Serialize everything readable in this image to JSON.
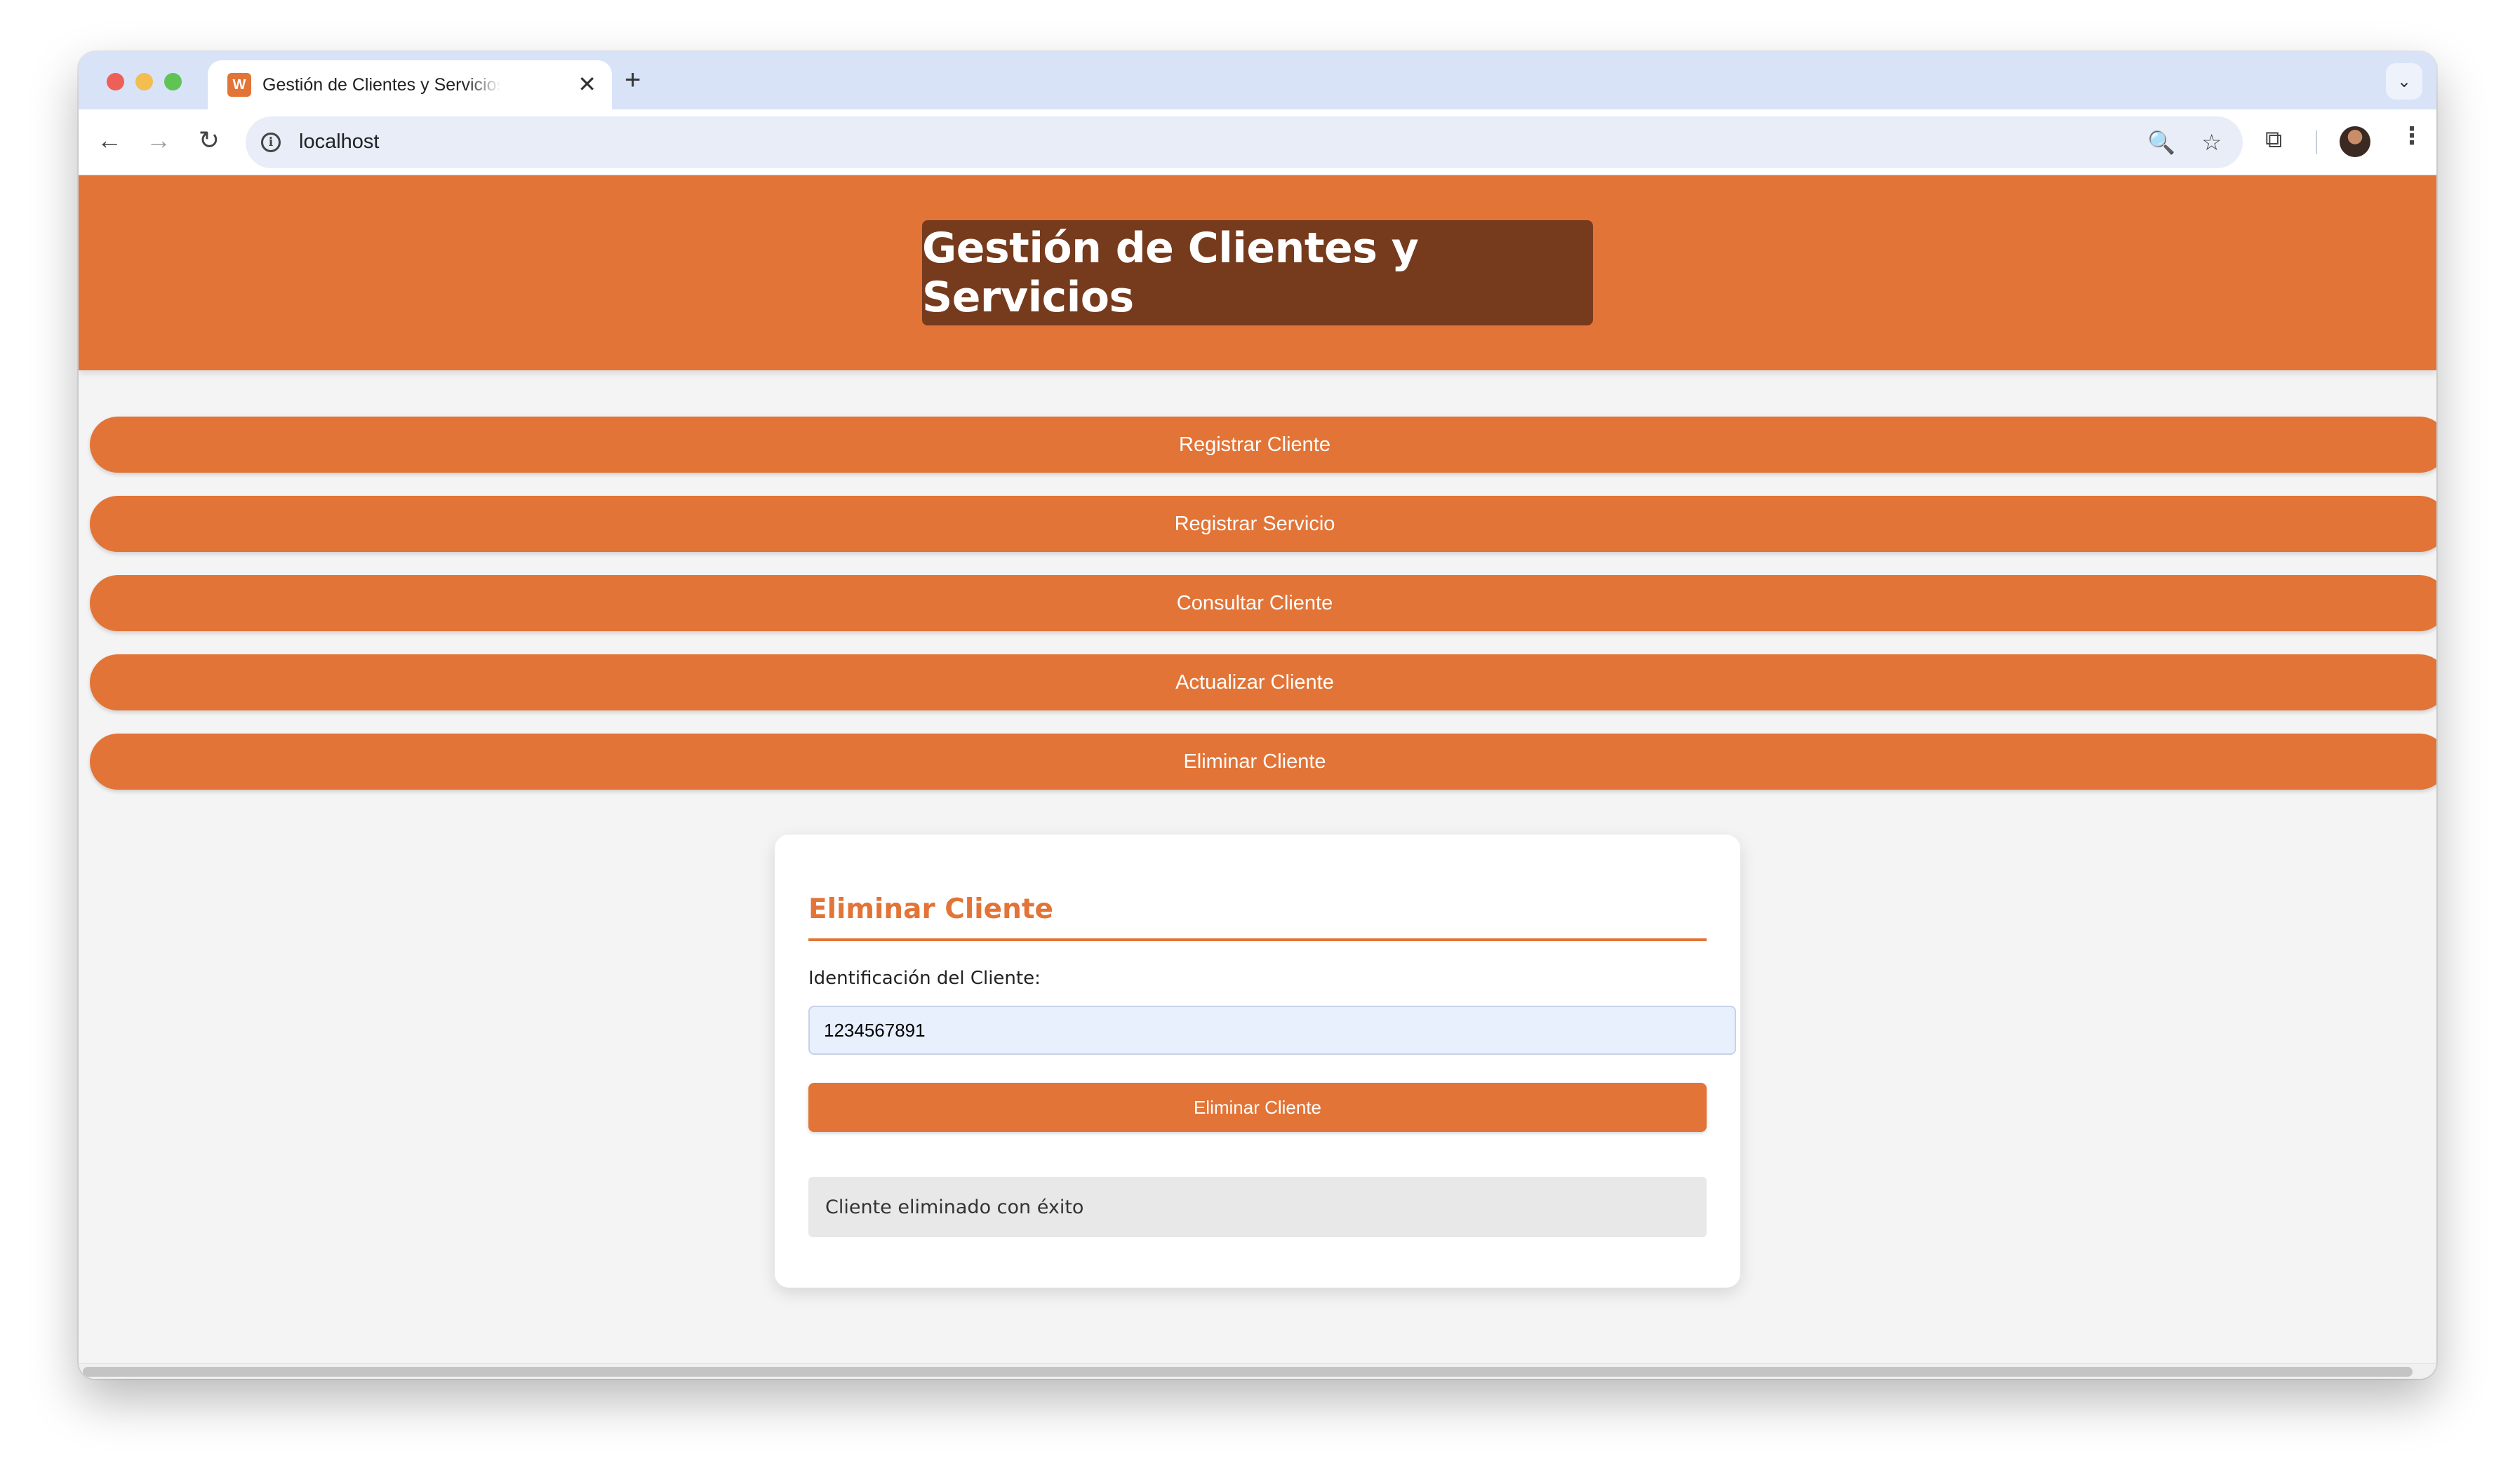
{
  "browser": {
    "tab_title": "Gestión de Clientes y Servicios",
    "favicon_glyph": "W",
    "close_glyph": "✕",
    "new_tab_glyph": "+",
    "dropdown_glyph": "⌄",
    "url": "localhost",
    "icons": {
      "back": "←",
      "forward": "→",
      "reload": "↻",
      "info": "i",
      "zoom": "🔍",
      "star": "☆",
      "extensions": "⧉",
      "menu": "⋮"
    }
  },
  "header": {
    "title": "Gestión de Clientes y Servicios"
  },
  "nav": {
    "items": [
      {
        "label": "Registrar Cliente"
      },
      {
        "label": "Registrar Servicio"
      },
      {
        "label": "Consultar Cliente"
      },
      {
        "label": "Actualizar Cliente"
      },
      {
        "label": "Eliminar Cliente"
      }
    ]
  },
  "form": {
    "title": "Eliminar Cliente",
    "id_label": "Identificación del Cliente:",
    "id_value": "1234567891",
    "submit_label": "Eliminar Cliente",
    "result_message": "Cliente eliminado con éxito"
  },
  "colors": {
    "accent": "#e27437",
    "header_title_bg": "#763a1d",
    "page_bg": "#f4f4f4",
    "tabstrip_bg": "#d8e3f7"
  }
}
